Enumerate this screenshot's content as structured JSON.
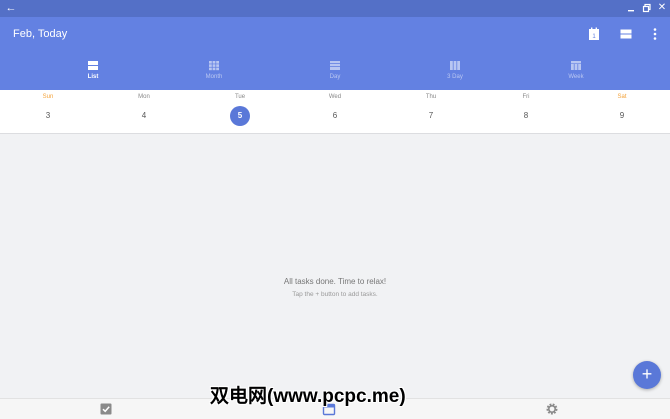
{
  "header": {
    "title": "Feb, Today"
  },
  "tabs": [
    {
      "label": "List",
      "active": true
    },
    {
      "label": "Month",
      "active": false
    },
    {
      "label": "Day",
      "active": false
    },
    {
      "label": "3 Day",
      "active": false
    },
    {
      "label": "Week",
      "active": false
    }
  ],
  "calendar_icon_day": "1",
  "week": [
    {
      "name": "Sun",
      "date": "3",
      "weekend": true
    },
    {
      "name": "Mon",
      "date": "4"
    },
    {
      "name": "Tue",
      "date": "5",
      "today": true
    },
    {
      "name": "Wed",
      "date": "6"
    },
    {
      "name": "Thu",
      "date": "7"
    },
    {
      "name": "Fri",
      "date": "8"
    },
    {
      "name": "Sat",
      "date": "9",
      "weekend": true
    }
  ],
  "empty_state": {
    "title": "All tasks done. Time to relax!",
    "subtitle": "Tap the + button to add tasks."
  },
  "fab_symbol": "+",
  "watermark": "双电网(www.pcpc.me)",
  "colors": {
    "titlebar": "#5470c7",
    "appbar": "#6381e2",
    "accent": "#5a78d8",
    "weekend": "#f4a33a",
    "background": "#f1f2f4"
  },
  "icons": {
    "titlebar": [
      "back-arrow-icon",
      "minimize-icon",
      "restore-icon",
      "close-icon"
    ],
    "appbar": [
      "calendar-today-icon",
      "view-toggle-icon",
      "more-vert-icon"
    ],
    "bottom_nav": [
      "tasks-check-icon",
      "calendar-icon",
      "settings-gear-icon"
    ]
  }
}
